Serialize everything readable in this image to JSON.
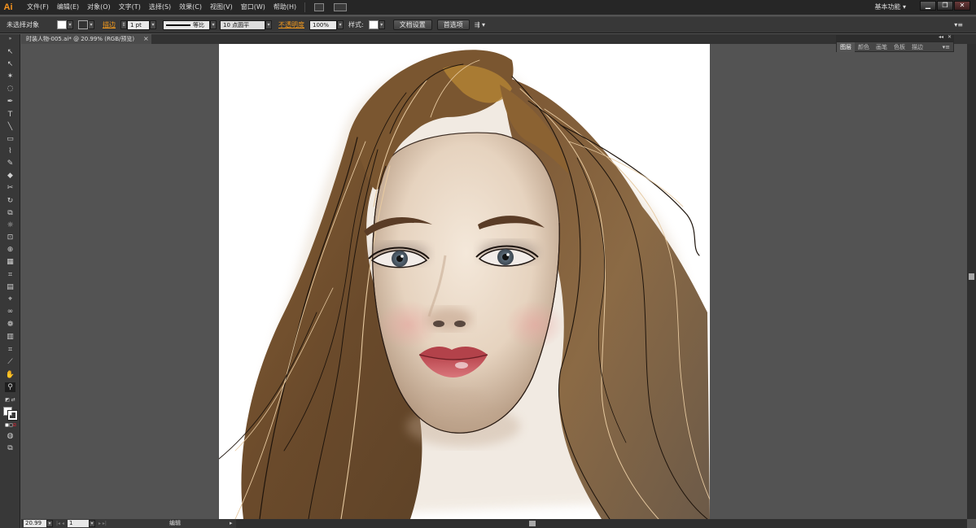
{
  "app": {
    "logo": "Ai"
  },
  "menu": [
    "文件(F)",
    "编辑(E)",
    "对象(O)",
    "文字(T)",
    "选择(S)",
    "效果(C)",
    "视图(V)",
    "窗口(W)",
    "帮助(H)"
  ],
  "workspace": "基本功能",
  "window_controls": [
    "▁",
    "❐",
    "✕"
  ],
  "control_bar": {
    "selection": "未选择对象",
    "stroke_label": "描边",
    "stroke_weight": "1 pt",
    "stroke_profile": "等比",
    "brush": "10 点圆平",
    "opacity_label": "不透明度",
    "opacity_value": "100%",
    "style_label": "样式:",
    "doc_setup_button": "文档设置",
    "preferences_button": "首选项"
  },
  "document_tab": {
    "title": "时装人物-005.ai* @ 20.99% (RGB/预览)",
    "close": "×"
  },
  "panel": {
    "tabs": [
      "图层",
      "颜色",
      "画笔",
      "色板",
      "描边"
    ]
  },
  "status_bar": {
    "zoom": "20.99",
    "artboard": "1",
    "label": "编辑"
  },
  "colors": {
    "accent": "#f39a1e",
    "menubar": "#262626",
    "workspace": "#535353",
    "skin": "#eadbc8",
    "hair": "#6b4a2a",
    "lips": "#c24a52"
  }
}
